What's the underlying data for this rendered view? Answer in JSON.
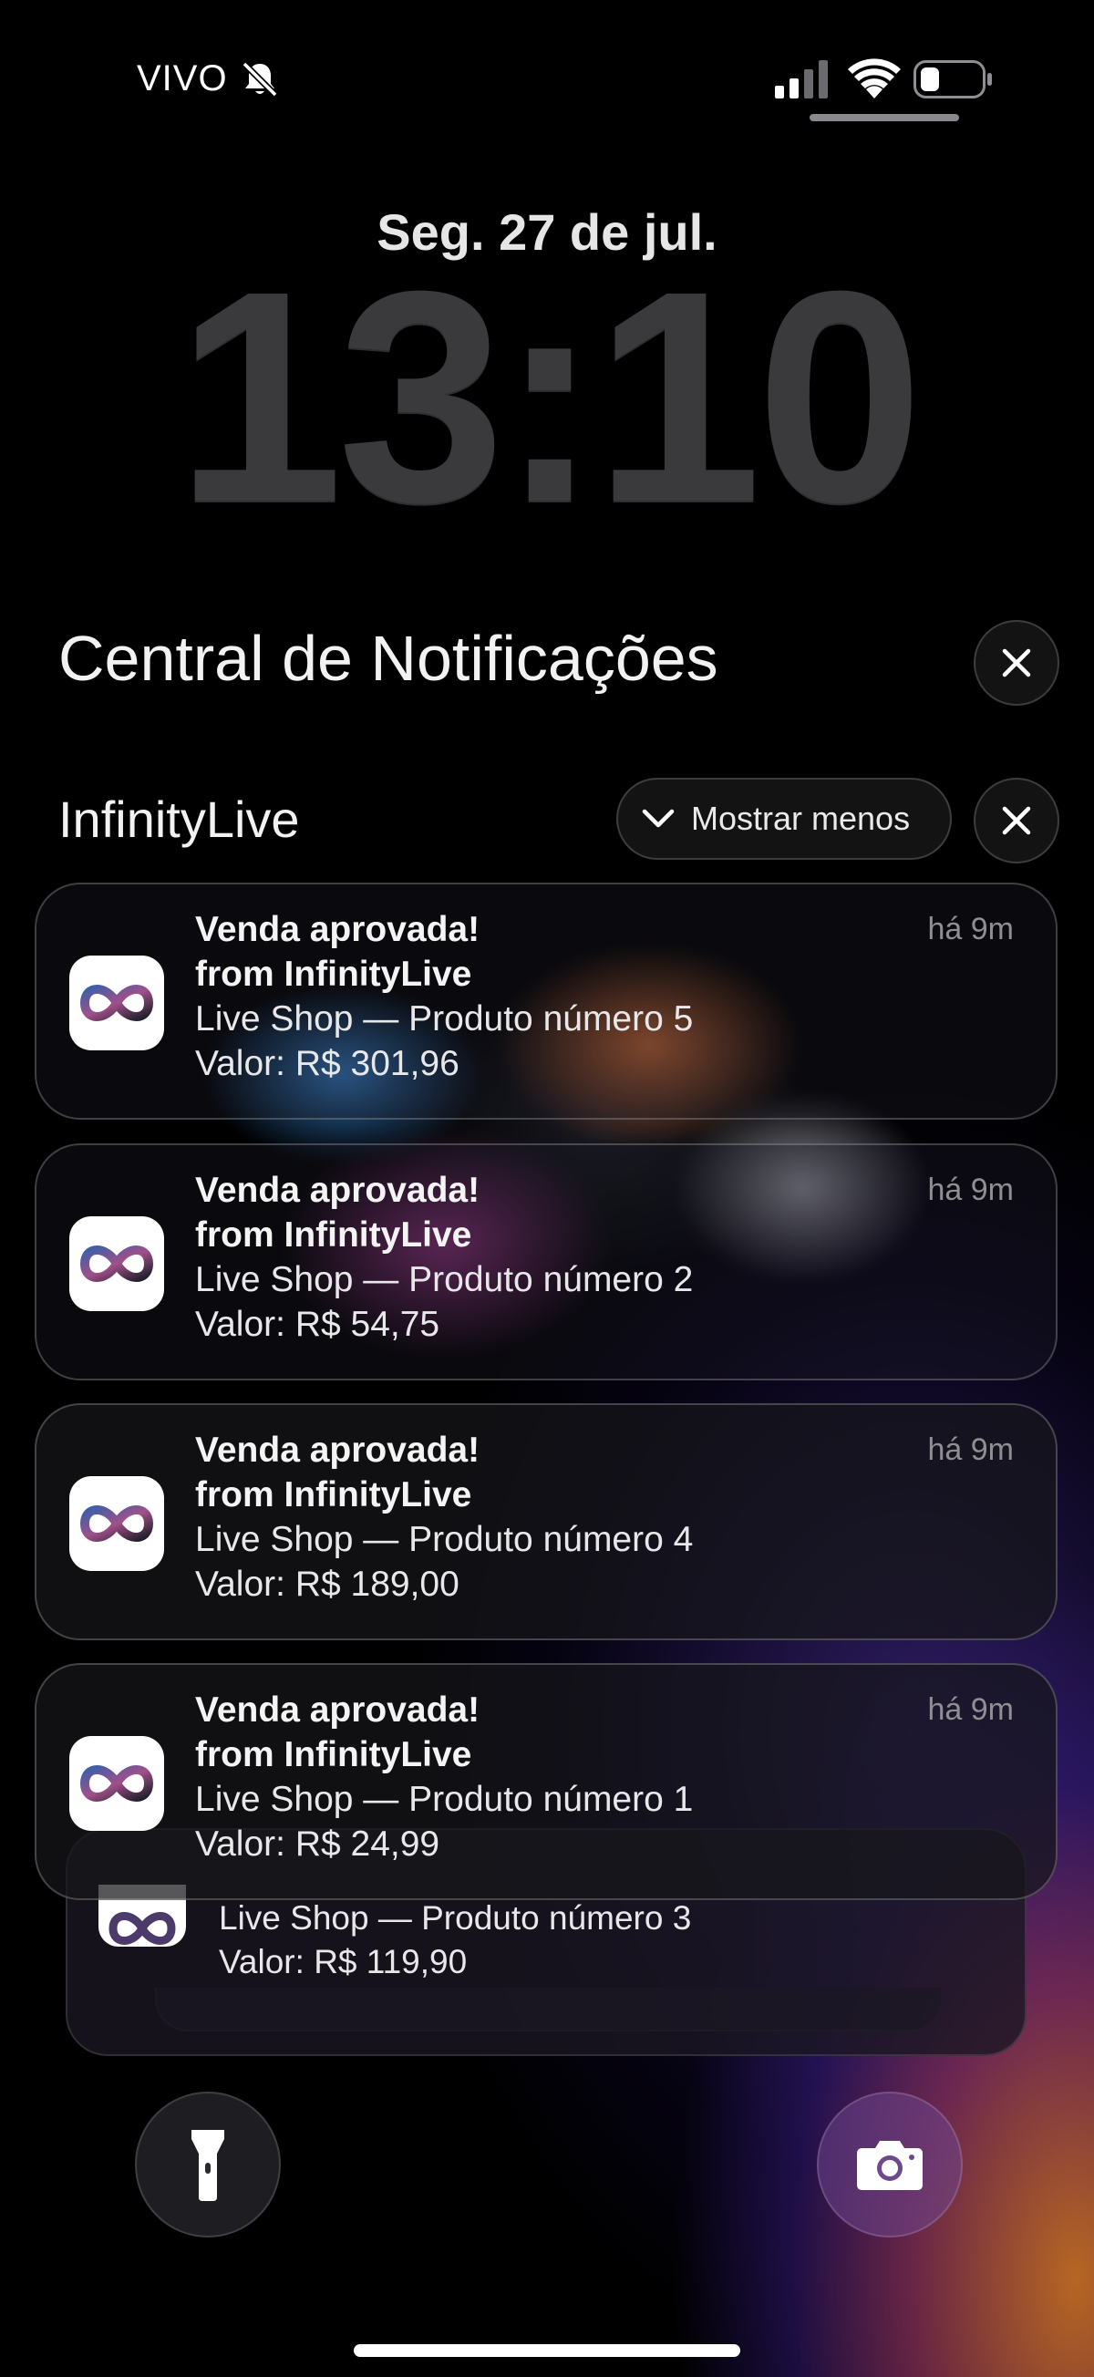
{
  "status_bar": {
    "carrier": "VIVO",
    "icons": [
      "bell-slash-icon",
      "cellular-signal-icon",
      "wifi-icon",
      "battery-icon"
    ]
  },
  "lock_screen": {
    "date": "Seg. 27 de jul.",
    "time": "13:10"
  },
  "notification_center": {
    "title": "Central de Notificações",
    "group": {
      "app_name": "InfinityLive",
      "show_less_label": "Mostrar menos",
      "notifications": [
        {
          "title": "Venda aprovada!",
          "subtitle": "from InfinityLive",
          "body": "Live Shop — Produto número 5",
          "value": "Valor: R$ 301,96",
          "time": "há 9m"
        },
        {
          "title": "Venda aprovada!",
          "subtitle": "from InfinityLive",
          "body": "Live Shop — Produto número 2",
          "value": "Valor: R$ 54,75",
          "time": "há 9m"
        },
        {
          "title": "Venda aprovada!",
          "subtitle": "from InfinityLive",
          "body": "Live Shop — Produto número 4",
          "value": "Valor: R$ 189,00",
          "time": "há 9m"
        },
        {
          "title": "Venda aprovada!",
          "subtitle": "from InfinityLive",
          "body": "Live Shop — Produto número 1",
          "value": "Valor: R$ 24,99",
          "time": "há 9m"
        },
        {
          "body": "Live Shop — Produto número 3",
          "value": "Valor: R$ 119,90"
        }
      ]
    }
  },
  "quick_actions": [
    "flashlight-icon",
    "camera-icon"
  ]
}
